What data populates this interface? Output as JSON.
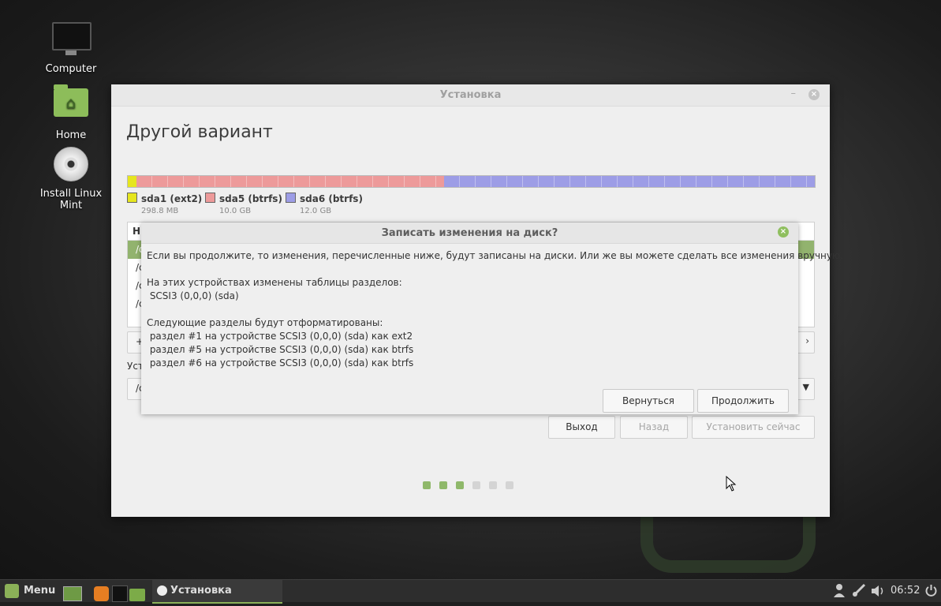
{
  "desktop": {
    "icons": [
      {
        "label": "Computer",
        "icon": "computer-icon"
      },
      {
        "label": "Home",
        "icon": "home-folder-icon"
      },
      {
        "label": "Install Linux Mint",
        "icon": "disc-icon"
      }
    ]
  },
  "window": {
    "title": "Установка",
    "minimize_glyph": "–",
    "close_glyph": "×",
    "heading": "Другой вариант",
    "partition_bar": [
      {
        "name": "sda1 (ext2)",
        "size": "298.8 MB",
        "color": "#e6e61e",
        "fraction": 0.013
      },
      {
        "name": "sda5 (btrfs)",
        "size": "10.0 GB",
        "color": "#ed9a9a",
        "fraction": 0.447
      },
      {
        "name": "sda6 (btrfs)",
        "size": "12.0 GB",
        "color": "#9d9de6",
        "fraction": 0.54
      }
    ],
    "table_header_fragment": "Н",
    "table_rows_fragments": [
      "/d",
      "/c",
      "/c",
      "/c"
    ],
    "pm_button_fragment": "+",
    "label_fragment": "Уст",
    "combo_fragment": "/c",
    "buttons": {
      "quit": "Выход",
      "back": "Назад",
      "install": "Установить сейчас"
    },
    "progress_dots": {
      "total": 6,
      "completed": 3,
      "active_color": "#8fb86a",
      "inactive_color": "#d4d4d4"
    }
  },
  "dialog": {
    "title": "Записать изменения на диск?",
    "close_glyph": "×",
    "intro": "Если вы продолжите, то изменения, перечисленные ниже, будут записаны на диски. Или же вы можете сделать все изменения вручную.",
    "tables_heading": "На этих устройствах изменены таблицы разделов:",
    "tables_device": " SCSI3 (0,0,0) (sda)",
    "format_heading": "Следующие разделы будут отформатированы:",
    "format_items": [
      " раздел #1 на устройстве SCSI3 (0,0,0) (sda) как ext2",
      " раздел #5 на устройстве SCSI3 (0,0,0) (sda) как btrfs",
      " раздел #6 на устройстве SCSI3 (0,0,0) (sda) как btrfs"
    ],
    "back_label": "Вернуться",
    "continue_label": "Продолжить"
  },
  "taskbar": {
    "menu_label": "Menu",
    "task_label": "Установка",
    "clock": "06:52",
    "accent": "#8bb158"
  }
}
